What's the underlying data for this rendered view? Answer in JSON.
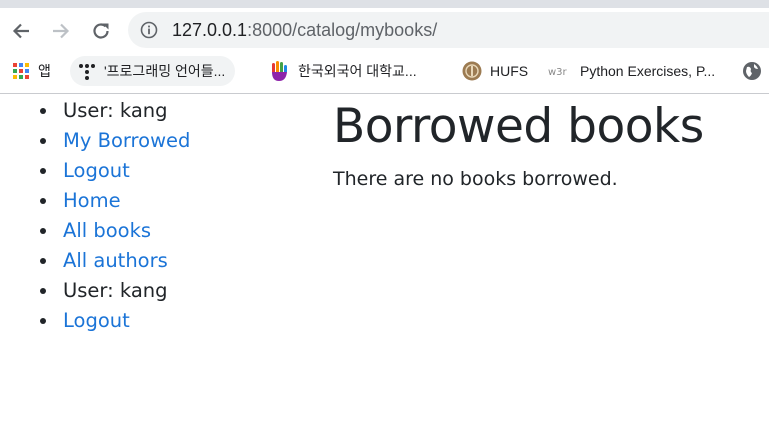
{
  "browser": {
    "url_host": "127.0.0.1",
    "url_rest": ":8000/catalog/mybooks/",
    "bookmarks": [
      {
        "label": "앱",
        "icon": "apps-grid-icon"
      },
      {
        "label": "'프로그래밍 언어들...",
        "icon": "t-dots-icon"
      },
      {
        "label": "한국외국어 대학교...",
        "icon": "hand-logo-icon"
      },
      {
        "label": "HUFS",
        "icon": "hufs-seal-icon"
      },
      {
        "label": "Python Exercises, P...",
        "icon": "w3r-icon"
      },
      {
        "label": "",
        "icon": "globe-icon"
      }
    ]
  },
  "sidebar": {
    "items": [
      {
        "label": "User: kang",
        "link": false
      },
      {
        "label": "My Borrowed",
        "link": true
      },
      {
        "label": "Logout",
        "link": true
      },
      {
        "label": "Home",
        "link": true
      },
      {
        "label": "All books",
        "link": true
      },
      {
        "label": "All authors",
        "link": true
      },
      {
        "label": "User: kang",
        "link": false
      },
      {
        "label": "Logout",
        "link": true
      }
    ]
  },
  "main": {
    "title": "Borrowed books",
    "message": "There are no books borrowed."
  },
  "colors": {
    "link": "#1b74d7",
    "text": "#212529",
    "omnibox": "#f1f3f4"
  }
}
